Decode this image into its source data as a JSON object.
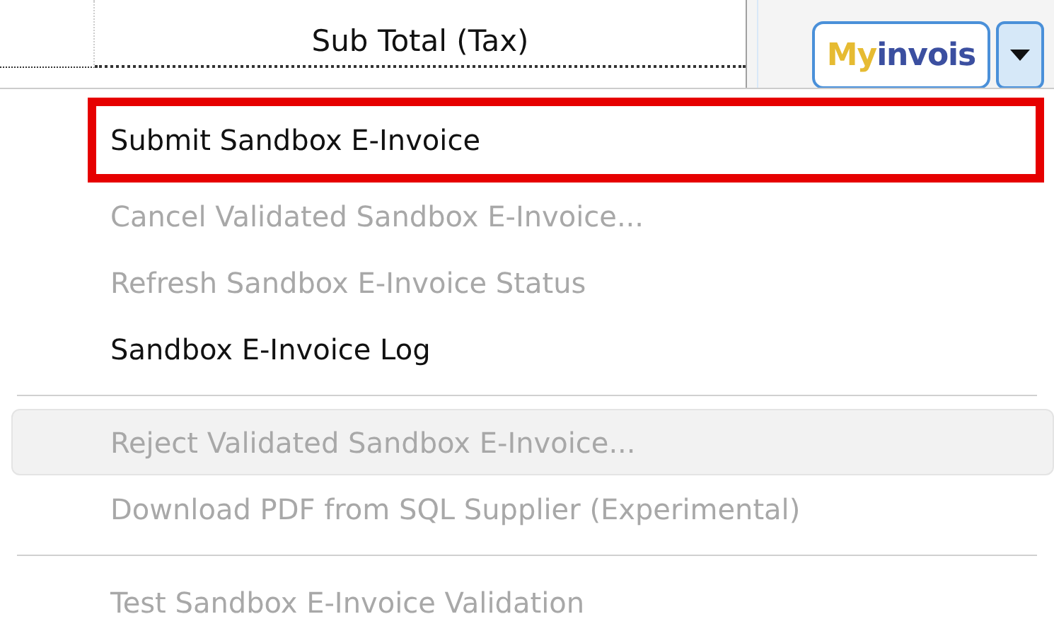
{
  "table": {
    "columns": [
      {
        "kind": "blank"
      },
      {
        "kind": "text",
        "label": "Sub Total (Tax)"
      }
    ]
  },
  "logo_button": {
    "part_1": "My",
    "part_2": "invois"
  },
  "menu": {
    "items": [
      {
        "kind": "item",
        "label": "Submit Sandbox E-Invoice",
        "disabled": false,
        "highlighted": true,
        "hovered": false
      },
      {
        "kind": "item",
        "label": "Cancel Validated Sandbox E-Invoice...",
        "disabled": true,
        "highlighted": false,
        "hovered": false
      },
      {
        "kind": "item",
        "label": "Refresh Sandbox E-Invoice Status",
        "disabled": true,
        "highlighted": false,
        "hovered": false
      },
      {
        "kind": "item",
        "label": "Sandbox E-Invoice Log",
        "disabled": false,
        "highlighted": false,
        "hovered": false
      },
      {
        "kind": "separator"
      },
      {
        "kind": "item",
        "label": "Reject Validated Sandbox E-Invoice...",
        "disabled": true,
        "highlighted": false,
        "hovered": true
      },
      {
        "kind": "item",
        "label": "Download PDF from SQL Supplier (Experimental)",
        "disabled": true,
        "highlighted": false,
        "hovered": false
      },
      {
        "kind": "separator"
      },
      {
        "kind": "item",
        "label": "Test Sandbox E-Invoice Validation",
        "disabled": true,
        "highlighted": false,
        "hovered": false
      }
    ]
  }
}
